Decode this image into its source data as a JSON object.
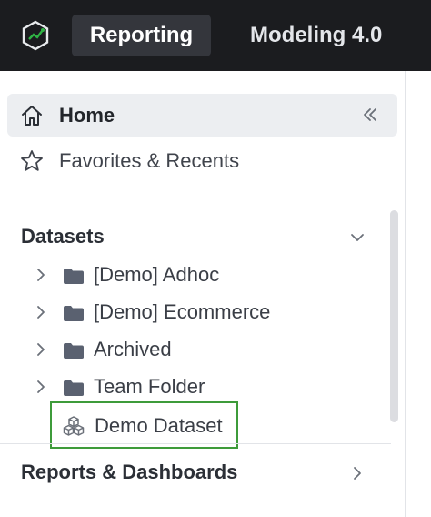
{
  "topbar": {
    "logo_icon": "hexagon-logo-icon",
    "tabs": [
      {
        "label": "Reporting",
        "active": true
      },
      {
        "label": "Modeling 4.0",
        "active": false
      }
    ]
  },
  "sidebar": {
    "home": {
      "label": "Home",
      "icon": "home-icon",
      "collapse_icon": "double-chevron-left-icon"
    },
    "favorites": {
      "label": "Favorites & Recents",
      "icon": "star-icon"
    },
    "datasets": {
      "title": "Datasets",
      "expanded": true,
      "items": [
        {
          "label": "[Demo] Adhoc",
          "icon": "folder-icon"
        },
        {
          "label": "[Demo] Ecommerce",
          "icon": "folder-icon"
        },
        {
          "label": "Archived",
          "icon": "folder-icon"
        },
        {
          "label": "Team Folder",
          "icon": "folder-icon"
        }
      ],
      "selected": {
        "label": "Demo Dataset",
        "icon": "cubes-icon"
      }
    },
    "reports": {
      "title": "Reports & Dashboards",
      "expanded": false
    }
  },
  "colors": {
    "topbar_bg": "#1b1c1f",
    "active_tab_bg": "#34363c",
    "logo_green": "#2fb344",
    "selection_border": "#3e9b3a",
    "home_bg": "#eceef1",
    "folder": "#5a6170"
  }
}
